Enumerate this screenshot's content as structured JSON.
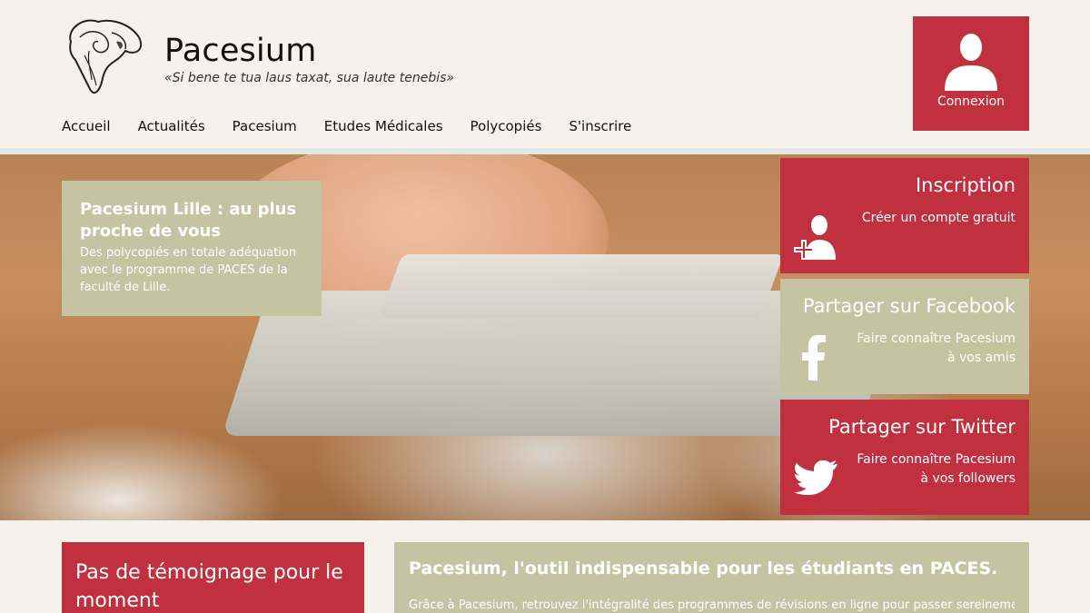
{
  "header": {
    "title": "Pacesium",
    "motto": "«Si bene te tua laus taxat, sua laute tenebis»",
    "nav": [
      "Accueil",
      "Actualités",
      "Pacesium",
      "Etudes Médicales",
      "Polycopiés",
      "S'inscrire"
    ],
    "login_label": "Connexion"
  },
  "hero": {
    "card_title": "Pacesium Lille : au plus proche de vous",
    "card_text": "Des polycopiés en totale adéquation avec le programme de PACES de la faculté de Lille."
  },
  "tiles": {
    "inscription": {
      "title": "Inscription",
      "sub": "Créer un compte gratuit",
      "icon": "user-add-icon"
    },
    "facebook": {
      "title": "Partager sur Facebook",
      "sub1": "Faire connaître Pacesium",
      "sub2": "à vos amis",
      "icon": "facebook-icon"
    },
    "twitter": {
      "title": "Partager sur Twitter",
      "sub1": "Faire connaître Pacesium",
      "sub2": "à vos followers",
      "icon": "twitter-icon"
    }
  },
  "bottom": {
    "testimony": "Pas de témoignage pour le moment",
    "promo_title": "Pacesium, l'outil indispensable pour les étudiants en PACES.",
    "promo_text": "Grâce à Pacesium, retrouvez l'intégralité des programmes de révisions en ligne pour passer sereinement"
  },
  "colors": {
    "accent_red": "#c0303f",
    "accent_olive": "#c5c3a1",
    "background": "#f4f2ea"
  }
}
